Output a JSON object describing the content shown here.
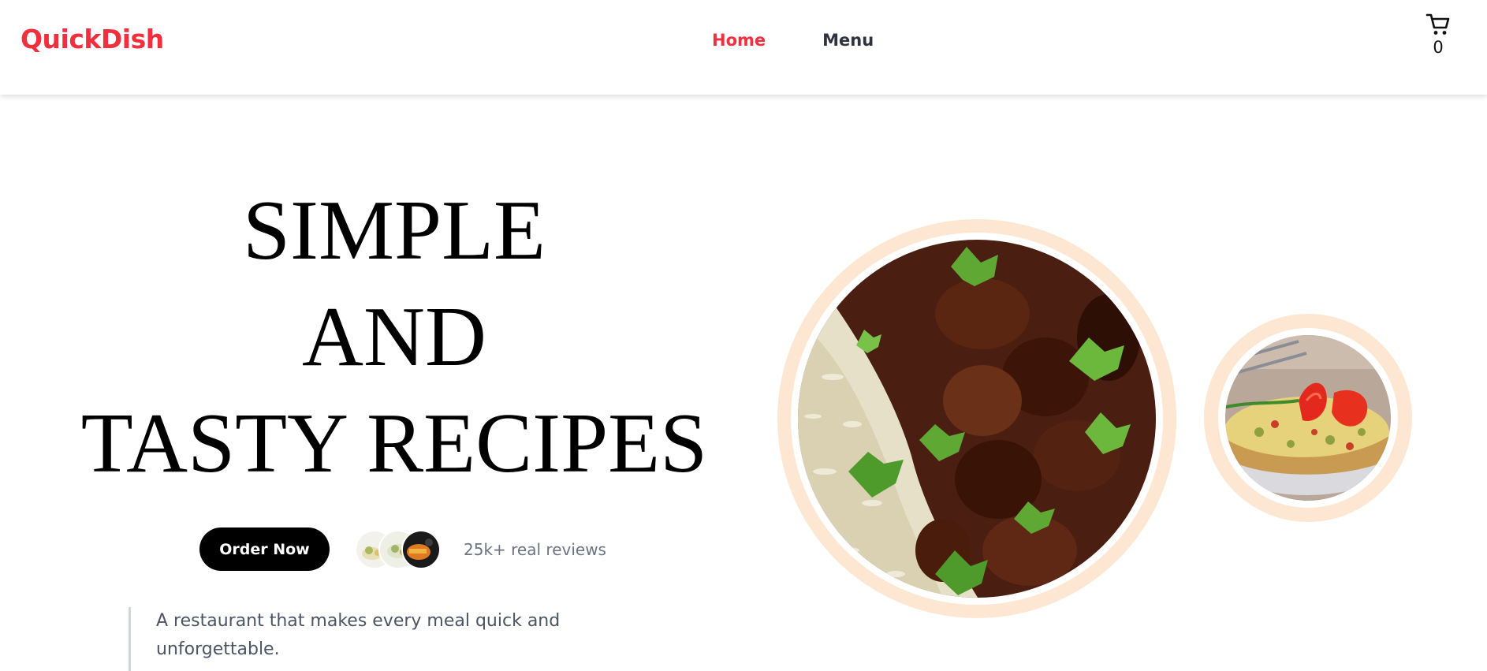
{
  "header": {
    "logo": "QuickDish",
    "nav": [
      {
        "label": "Home",
        "active": true
      },
      {
        "label": "Menu",
        "active": false
      }
    ],
    "cart": {
      "icon": "cart-icon",
      "count": "0"
    }
  },
  "hero": {
    "title_lines": [
      "SIMPLE",
      "AND",
      "TASTY RECIPES"
    ],
    "order_button": "Order Now",
    "reviews_text": "25k+ real reviews",
    "tagline": "A restaurant that makes every meal quick and unforgettable."
  },
  "images": {
    "main_dish": "rice-and-beef-curry-with-cilantro",
    "side_dish": "frittata-with-tomato-slices"
  },
  "colors": {
    "accent": "#f0303f",
    "ring": "#fde7d2",
    "button": "#000000",
    "muted_text": "#6b7280"
  }
}
